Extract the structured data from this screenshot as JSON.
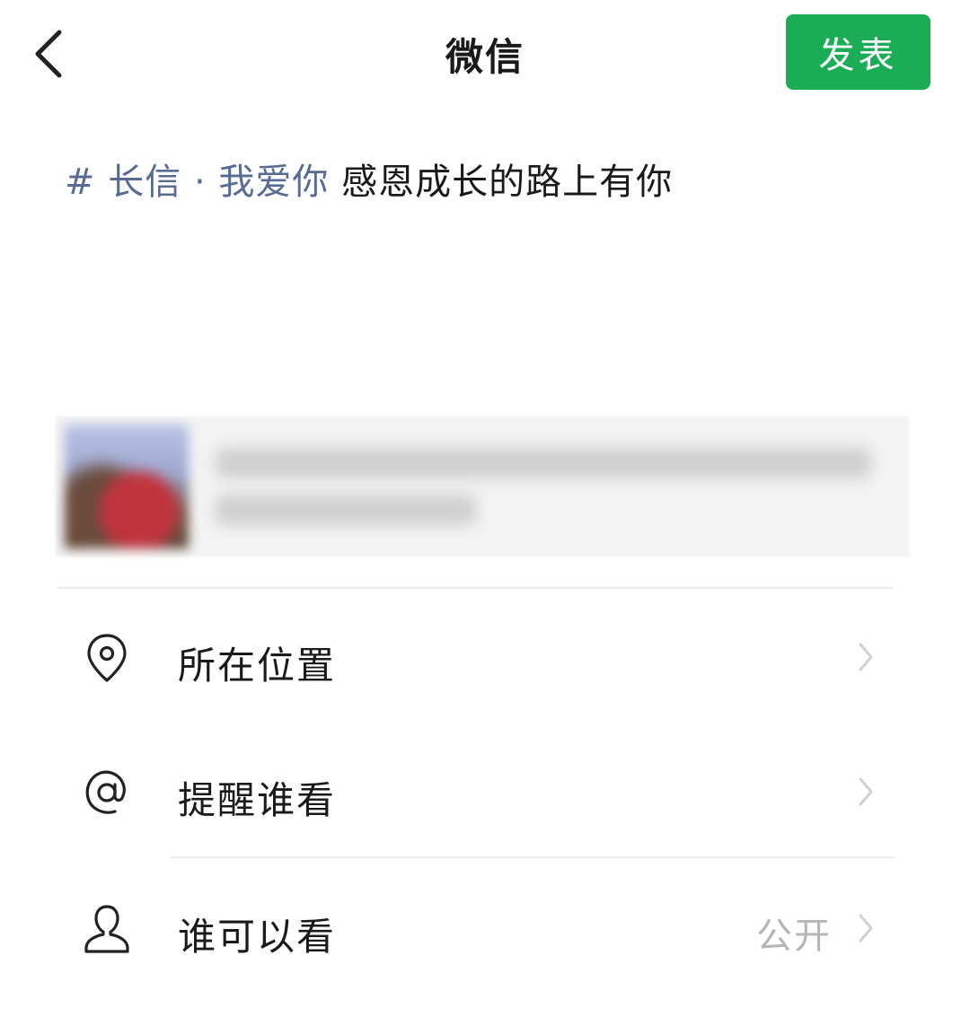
{
  "header": {
    "title": "微信",
    "publish_label": "发表"
  },
  "post": {
    "tag": "# 长信 · 我爱你",
    "text": " 感恩成长的路上有你"
  },
  "colors": {
    "accent": "#1aad56",
    "tag": "#576b95"
  },
  "options": [
    {
      "label": "所在位置",
      "icon": "location-pin-icon"
    },
    {
      "label": "提醒谁看",
      "icon": "at-icon"
    },
    {
      "label": "谁可以看",
      "icon": "person-icon",
      "value": "公开"
    }
  ]
}
